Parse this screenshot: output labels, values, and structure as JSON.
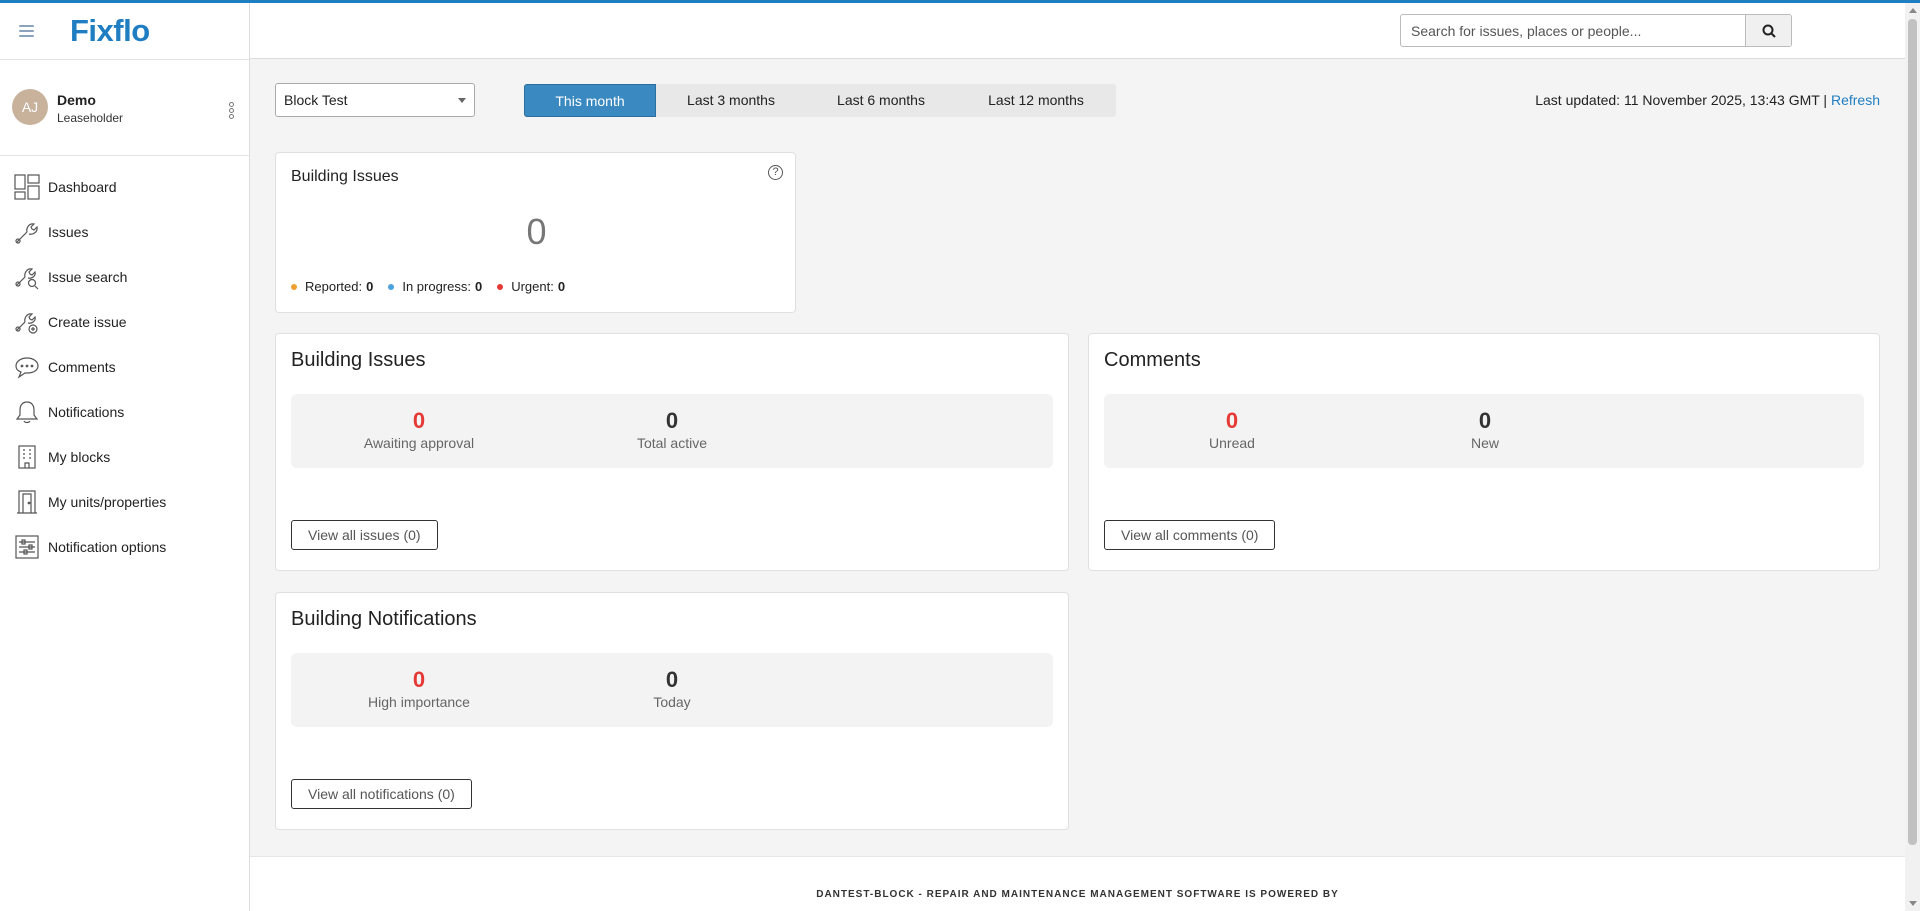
{
  "app": {
    "logo": "Fixflo",
    "accent": "#1f7ec2"
  },
  "user": {
    "initials": "AJ",
    "name": "Demo",
    "role": "Leaseholder"
  },
  "nav": [
    {
      "label": "Dashboard",
      "icon": "dashboard-icon"
    },
    {
      "label": "Issues",
      "icon": "wrench-icon"
    },
    {
      "label": "Issue search",
      "icon": "wrench-search-icon"
    },
    {
      "label": "Create issue",
      "icon": "wrench-add-icon"
    },
    {
      "label": "Comments",
      "icon": "speech-bubble-icon"
    },
    {
      "label": "Notifications",
      "icon": "bell-icon"
    },
    {
      "label": "My blocks",
      "icon": "building-icon"
    },
    {
      "label": "My units/properties",
      "icon": "door-icon"
    },
    {
      "label": "Notification options",
      "icon": "sliders-icon"
    }
  ],
  "search": {
    "placeholder": "Search for issues, places or people..."
  },
  "filter": {
    "block": "Block Test",
    "periods": [
      "This month",
      "Last 3 months",
      "Last 6 months",
      "Last 12 months"
    ],
    "active_period": "This month"
  },
  "updated": {
    "text": "Last updated: 11 November 2025, 13:43 GMT |",
    "refresh": "Refresh"
  },
  "summary": {
    "title": "Building Issues",
    "total": "0",
    "help": "?",
    "legend": [
      {
        "label": "Reported:",
        "value": "0",
        "color": "#f0a030"
      },
      {
        "label": "In progress:",
        "value": "0",
        "color": "#4aa3df"
      },
      {
        "label": "Urgent:",
        "value": "0",
        "color": "#e53935"
      }
    ]
  },
  "issues_card": {
    "title": "Building Issues",
    "stats": [
      {
        "value": "0",
        "label": "Awaiting approval"
      },
      {
        "value": "0",
        "label": "Total active"
      }
    ],
    "button": "View all issues (0)"
  },
  "comments_card": {
    "title": "Comments",
    "stats": [
      {
        "value": "0",
        "label": "Unread"
      },
      {
        "value": "0",
        "label": "New"
      }
    ],
    "button": "View all comments (0)"
  },
  "notifications_card": {
    "title": "Building Notifications",
    "stats": [
      {
        "value": "0",
        "label": "High importance"
      },
      {
        "value": "0",
        "label": "Today"
      }
    ],
    "button": "View all notifications (0)"
  },
  "footer": {
    "text": "DANTEST-BLOCK - REPAIR AND MAINTENANCE MANAGEMENT SOFTWARE IS POWERED BY"
  }
}
